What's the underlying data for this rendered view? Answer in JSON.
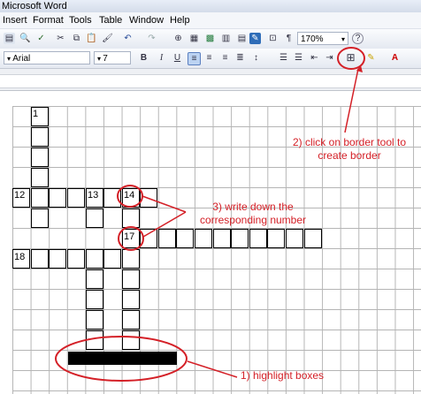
{
  "window": {
    "title": "Microsoft Word"
  },
  "menu": [
    "Insert",
    "Format",
    "Tools",
    "Table",
    "Window",
    "Help"
  ],
  "toolbar": {
    "zoom": "170%",
    "font": "Arial",
    "size": "7",
    "bold": "B",
    "italic": "I",
    "underline": "U",
    "paragraph_mark": "¶"
  },
  "crossword": {
    "numbers": [
      "1",
      "12",
      "13",
      "14",
      "17",
      "18"
    ]
  },
  "annotations": {
    "step1": "1) highlight boxes",
    "step2_line1": "2) click on border tool to",
    "step2_line2": "create border",
    "step3_line1": "3) write down the",
    "step3_line2": "corresponding number"
  },
  "colors": {
    "annotation": "#d42027",
    "grid": "#b5b5b5"
  },
  "icons": [
    "new-icon",
    "print-preview-icon",
    "spell-check-icon",
    "cut-icon",
    "copy-icon",
    "paste-icon",
    "format-painter-icon",
    "undo-icon",
    "redo-icon",
    "hyperlink-icon",
    "table-icon",
    "excel-icon",
    "columns-icon",
    "drawing-icon",
    "document-map-icon",
    "show-hide-icon",
    "help-icon",
    "align-left-icon",
    "align-center-icon",
    "align-right-icon",
    "justify-icon",
    "line-spacing-icon",
    "numbering-icon",
    "bullets-icon",
    "decrease-indent-icon",
    "increase-indent-icon",
    "border-icon",
    "highlight-icon",
    "font-color-icon"
  ]
}
